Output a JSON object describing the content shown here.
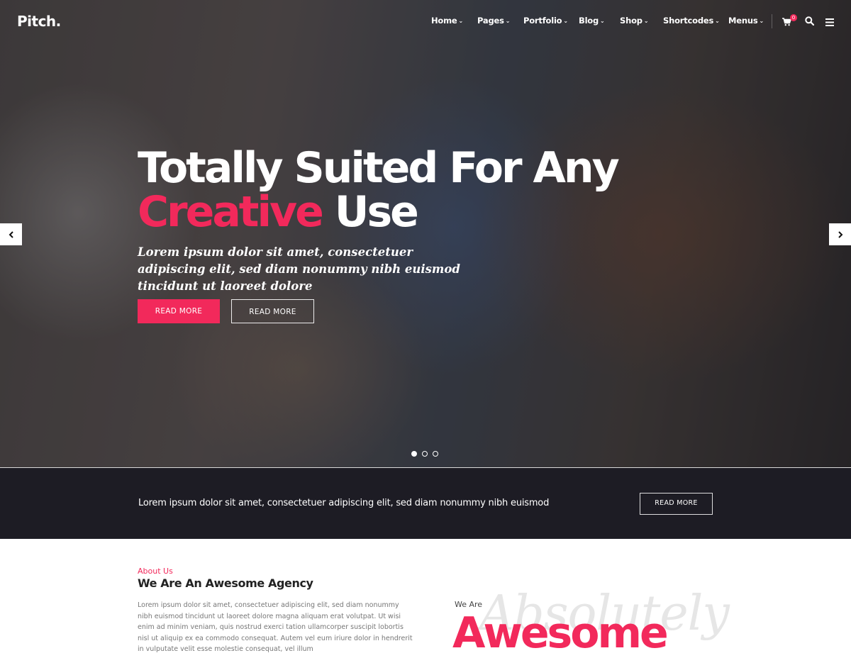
{
  "header": {
    "logo": "Pitch.",
    "nav": [
      {
        "label": "Home"
      },
      {
        "label": "Pages"
      },
      {
        "label": "Portfolio"
      },
      {
        "label": "Blog"
      },
      {
        "label": "Shop"
      },
      {
        "label": "Shortcodes"
      },
      {
        "label": "Menus"
      }
    ],
    "cart_count": "0",
    "icons": [
      "cart-icon",
      "search-icon",
      "menu-icon"
    ]
  },
  "hero": {
    "title_line1": "Totally Suited For Any",
    "title_accent": "Creative",
    "title_rest": " Use",
    "subtitle": "Lorem ipsum dolor sit amet, consectetuer adipiscing elit, sed diam nonummy nibh euismod tincidunt ut laoreet dolore",
    "primary_button": "READ MORE",
    "secondary_button": "READ MORE",
    "slides_total": 3,
    "active_slide": 1,
    "accent_color": "#f2295b"
  },
  "cta": {
    "text": "Lorem ipsum dolor sit amet, consectetuer adipiscing elit, sed diam nonummy nibh euismod",
    "button": "READ MORE"
  },
  "about": {
    "kicker": "About Us",
    "heading": "We Are An Awesome Agency",
    "body": "Lorem ipsum dolor sit amet, consectetuer adipiscing elit, sed diam nonummy nibh euismod tincidunt ut laoreet dolore magna aliquam erat volutpat. Ut wisi enim ad minim veniam, quis nostrud exerci tation ullamcorper suscipit lobortis nisl ut aliquip ex ea commodo consequat. Autem vel eum iriure dolor in hendrerit in vulputate velit esse molestie consequat, vel illum",
    "we_are": "We Are",
    "script_word": "Absolutely",
    "big_word": "Awesome"
  }
}
